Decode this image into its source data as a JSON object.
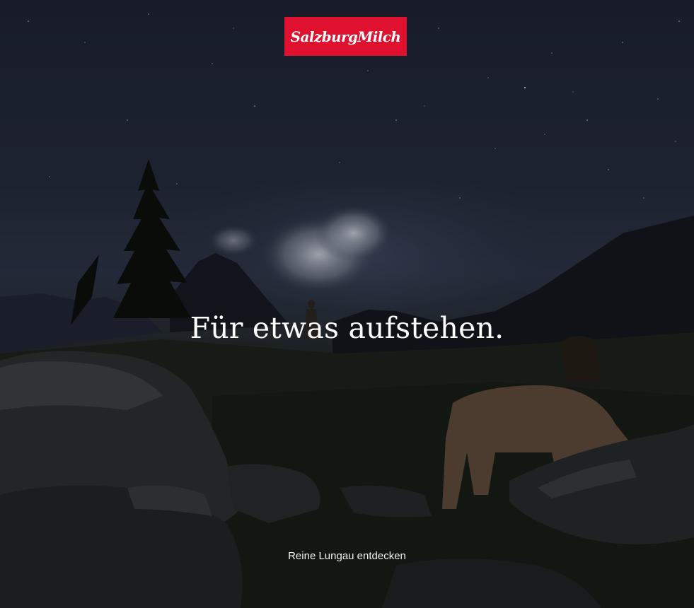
{
  "logo": {
    "text": "SalzburgMilch",
    "color": "#e0102f"
  },
  "hero": {
    "headline": "Für etwas aufstehen.",
    "cta_label": "Reine Lungau entdecken"
  }
}
